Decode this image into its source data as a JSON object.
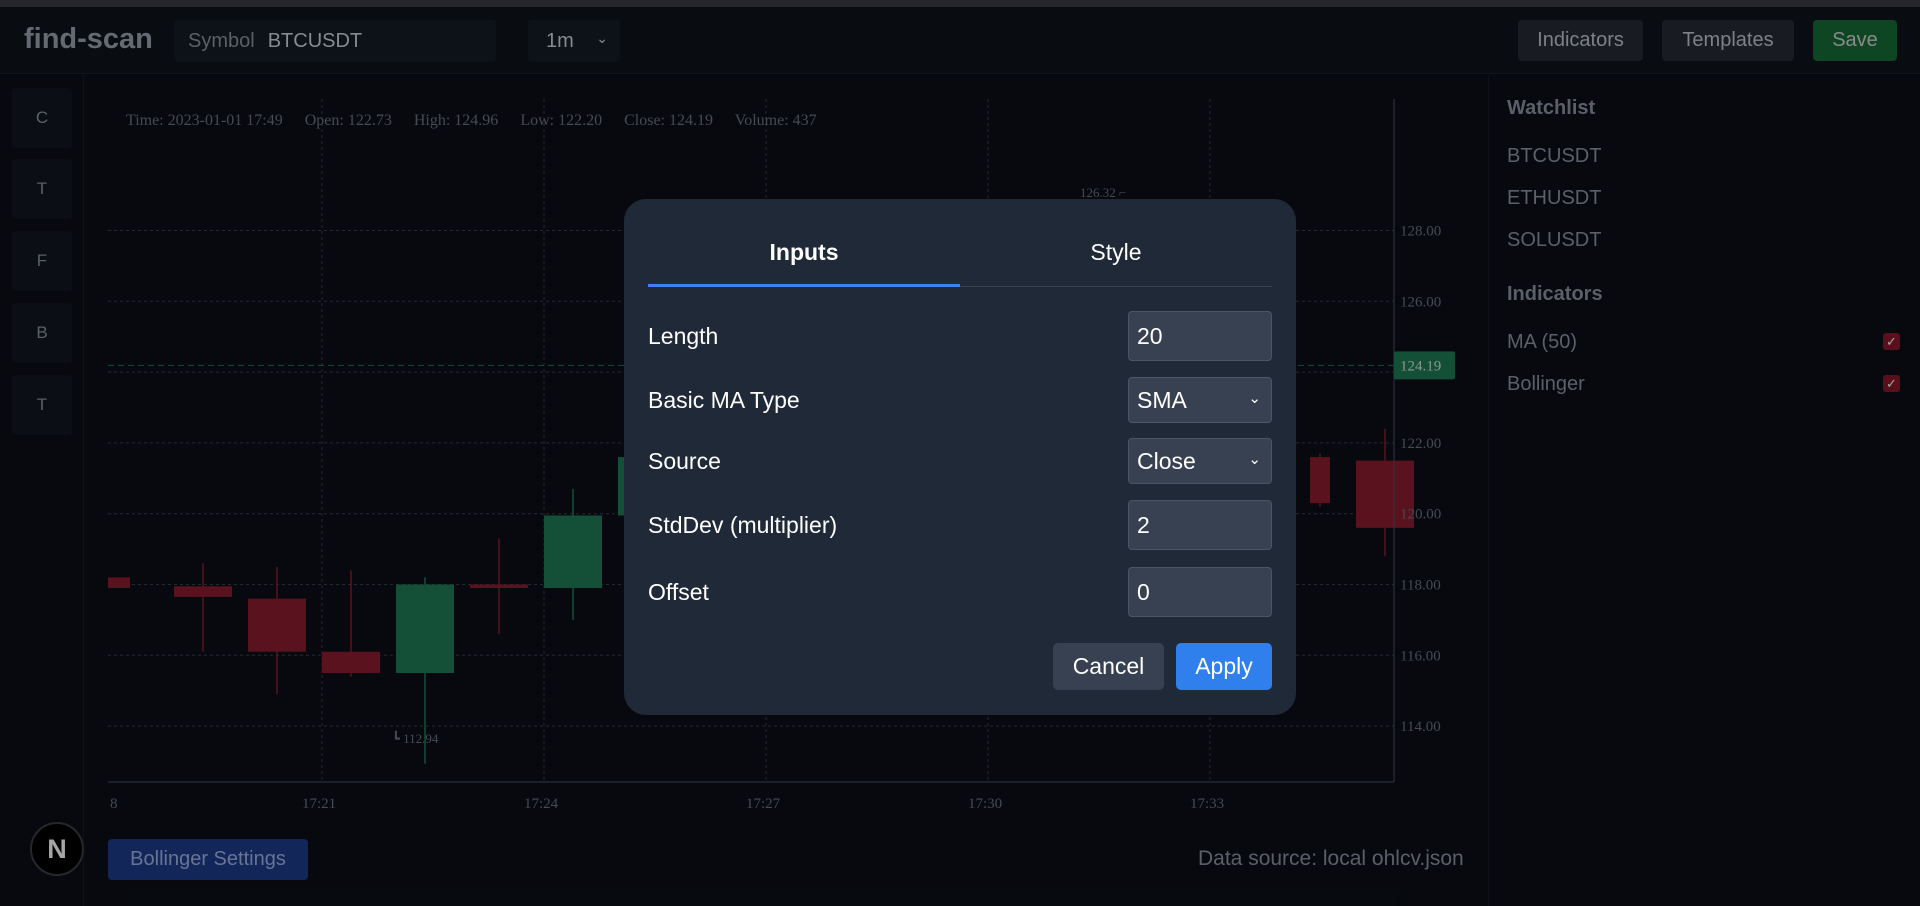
{
  "app": {
    "name": "find-scan"
  },
  "header": {
    "symbol_label": "Symbol",
    "symbol_value": "BTCUSDT",
    "timeframe": "1m",
    "indicators_label": "Indicators",
    "templates_label": "Templates",
    "save_label": "Save"
  },
  "toolbar": {
    "tools": [
      "C",
      "T",
      "F",
      "B",
      "T"
    ]
  },
  "chart": {
    "ohlc": {
      "time": "Time: 2023-01-01 17:49",
      "open": "Open: 122.73",
      "high": "High: 124.96",
      "low": "Low: 122.20",
      "close": "Close: 124.19",
      "volume": "Volume: 437"
    },
    "last_price_label": "124.19",
    "high_marker": "126.32",
    "low_marker": "112.94",
    "bollinger_button": "Bollinger Settings",
    "data_source": "Data source: local ohlcv.json"
  },
  "chart_data": {
    "type": "candlestick",
    "y_ticks": [
      "128.00",
      "126.00",
      "124.00",
      "122.00",
      "120.00",
      "118.00",
      "116.00",
      "114.00"
    ],
    "ylim": [
      112.5,
      128.5
    ],
    "x_ticks": [
      "8",
      "17:21",
      "17:24",
      "17:27",
      "17:30",
      "17:33"
    ],
    "last_price": 124.19,
    "up_color": "#1f7a55",
    "down_color": "#8a1c2e",
    "candles": [
      {
        "open": 118.2,
        "close": 117.9,
        "high": 118.2,
        "low": 117.9
      },
      {
        "open": 117.95,
        "close": 117.65,
        "high": 118.6,
        "low": 116.1
      },
      {
        "open": 117.6,
        "close": 116.1,
        "high": 118.5,
        "low": 114.9
      },
      {
        "open": 116.1,
        "close": 115.5,
        "high": 118.4,
        "low": 115.4
      },
      {
        "open": 115.5,
        "close": 118.0,
        "high": 118.2,
        "low": 112.94
      },
      {
        "open": 118.0,
        "close": 117.9,
        "high": 119.3,
        "low": 116.6
      },
      {
        "open": 117.9,
        "close": 119.95,
        "high": 120.7,
        "low": 117.0
      },
      {
        "open": 119.95,
        "close": 121.6,
        "high": 122.0,
        "low": 119.0
      },
      {
        "open": 121.6,
        "close": 120.3,
        "high": 121.7,
        "low": 120.2
      },
      {
        "open": 121.5,
        "close": 119.6,
        "high": 122.4,
        "low": 118.8
      }
    ]
  },
  "sidebar": {
    "watchlist_heading": "Watchlist",
    "watchlist": [
      "BTCUSDT",
      "ETHUSDT",
      "SOLUSDT"
    ],
    "indicators_heading": "Indicators",
    "indicators": [
      {
        "label": "MA (50)",
        "checked": true
      },
      {
        "label": "Bollinger",
        "checked": true
      }
    ]
  },
  "modal": {
    "tabs": [
      "Inputs",
      "Style"
    ],
    "active_tab": "Inputs",
    "fields": {
      "length": {
        "label": "Length",
        "value": "20"
      },
      "ma_type": {
        "label": "Basic MA Type",
        "value": "SMA"
      },
      "source": {
        "label": "Source",
        "value": "Close"
      },
      "stddev": {
        "label": "StdDev (multiplier)",
        "value": "2"
      },
      "offset": {
        "label": "Offset",
        "value": "0"
      }
    },
    "cancel_label": "Cancel",
    "apply_label": "Apply"
  },
  "colors": {
    "accent": "#2f80ed",
    "save": "#166b35",
    "up_candle": "#1f7a55",
    "down_candle": "#8a1c2e"
  }
}
